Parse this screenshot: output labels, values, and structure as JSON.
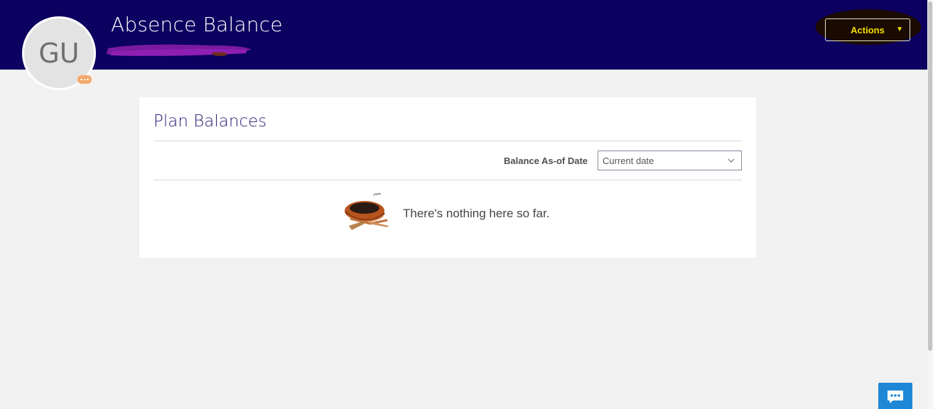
{
  "header": {
    "title": "Absence Balance",
    "avatar_initials": "GU",
    "actions_label": "Actions",
    "background_color": "#0c0060",
    "actions_text_color": "#f7e000"
  },
  "plan_balances": {
    "title": "Plan Balances",
    "balance_date_label": "Balance As-of Date",
    "balance_date_value": "Current date",
    "empty_message": "There's nothing here so far.",
    "empty_icon": "nest-icon"
  },
  "chat": {
    "icon": "chat-icon",
    "color": "#1e88d6"
  }
}
